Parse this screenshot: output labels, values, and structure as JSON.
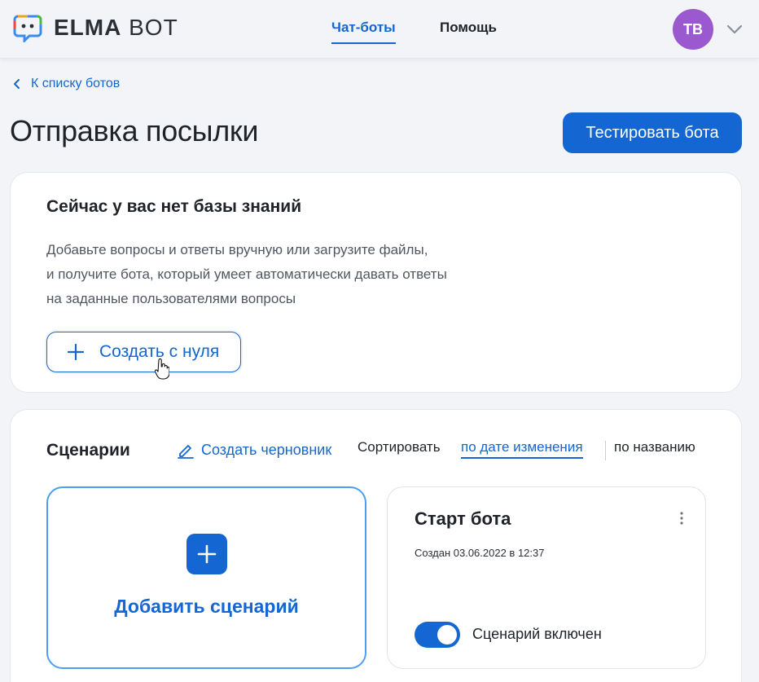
{
  "header": {
    "logo_bold": "ELMA",
    "logo_light": "BOT",
    "nav": [
      {
        "label": "Чат-боты",
        "active": true
      },
      {
        "label": "Помощь",
        "active": false
      }
    ],
    "avatar_initials": "TB",
    "avatar_color": "#9b59d0"
  },
  "back_link": "К списку ботов",
  "page_title": "Отправка посылки",
  "test_button": "Тестировать бота",
  "knowledge_base": {
    "title": "Сейчас у вас нет базы знаний",
    "description_lines": [
      "Добавьте вопросы и ответы вручную или загрузите файлы,",
      "и получите бота, который умеет автоматически давать ответы",
      "на заданные пользователями вопросы"
    ],
    "create_button": "Создать с нуля"
  },
  "scenarios": {
    "title": "Сценарии",
    "draft_link": "Создать черновник",
    "sort_label": "Сортировать",
    "sort_options": [
      "по дате изменения",
      "по названию"
    ],
    "sort_selected": "по дате изменения",
    "add_tile_label": "Добавить сценарий",
    "items": [
      {
        "name": "Старт бота",
        "created": "Создан 03.06.2022 в 12:37",
        "enabled": true,
        "toggle_label": "Сценарий включен"
      }
    ]
  },
  "colors": {
    "accent": "#1466d2",
    "background": "#f2f4f7"
  },
  "icons": [
    "elma-bot-logo-icon",
    "chevron-down-icon",
    "chevron-left-icon",
    "plus-icon",
    "pencil-icon",
    "kebab-menu-icon",
    "hand-cursor-icon"
  ]
}
